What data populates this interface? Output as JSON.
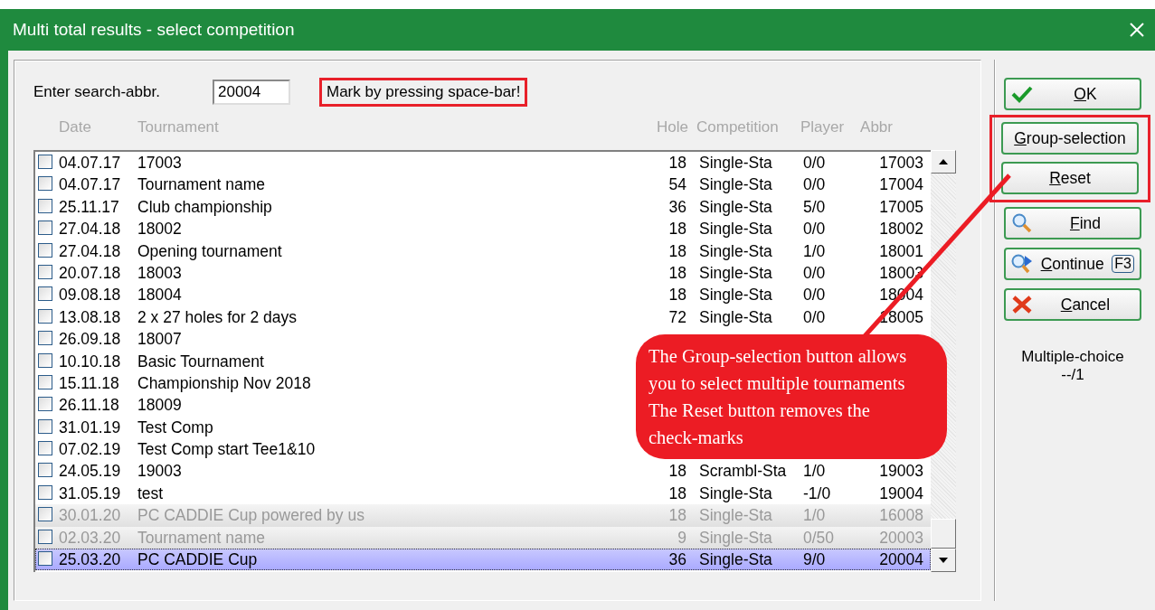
{
  "window": {
    "title": "Multi total results - select competition"
  },
  "search": {
    "label": "Enter search-abbr.",
    "value": "20004"
  },
  "hint": "Mark by pressing space-bar!",
  "table": {
    "columns": [
      "Date",
      "Tournament",
      "Hole",
      "Competition",
      "Player",
      "Abbr"
    ],
    "rows": [
      {
        "date": "04.07.17",
        "tournament": "17003",
        "hole": "18",
        "competition": "Single-Sta",
        "player": "0/0",
        "abbr": "17003",
        "checked": false,
        "selected": false,
        "greyed": false
      },
      {
        "date": "04.07.17",
        "tournament": "Tournament name",
        "hole": "54",
        "competition": "Single-Sta",
        "player": "0/0",
        "abbr": "17004",
        "checked": false,
        "selected": false,
        "greyed": false
      },
      {
        "date": "25.11.17",
        "tournament": "Club championship",
        "hole": "36",
        "competition": "Single-Sta",
        "player": "5/0",
        "abbr": "17005",
        "checked": false,
        "selected": false,
        "greyed": false
      },
      {
        "date": "27.04.18",
        "tournament": "18002",
        "hole": "18",
        "competition": "Single-Sta",
        "player": "0/0",
        "abbr": "18002",
        "checked": false,
        "selected": false,
        "greyed": false
      },
      {
        "date": "27.04.18",
        "tournament": "Opening tournament",
        "hole": "18",
        "competition": "Single-Sta",
        "player": "1/0",
        "abbr": "18001",
        "checked": false,
        "selected": false,
        "greyed": false
      },
      {
        "date": "20.07.18",
        "tournament": "18003",
        "hole": "18",
        "competition": "Single-Sta",
        "player": "0/0",
        "abbr": "18003",
        "checked": false,
        "selected": false,
        "greyed": false
      },
      {
        "date": "09.08.18",
        "tournament": "18004",
        "hole": "18",
        "competition": "Single-Sta",
        "player": "0/0",
        "abbr": "18004",
        "checked": false,
        "selected": false,
        "greyed": false
      },
      {
        "date": "13.08.18",
        "tournament": "2 x 27 holes for 2 days",
        "hole": "72",
        "competition": "Single-Sta",
        "player": "0/0",
        "abbr": "18005",
        "checked": false,
        "selected": false,
        "greyed": false
      },
      {
        "date": "26.09.18",
        "tournament": "18007",
        "checked": false,
        "selected": false,
        "greyed": false
      },
      {
        "date": "10.10.18",
        "tournament": "Basic Tournament",
        "checked": false,
        "selected": false,
        "greyed": false
      },
      {
        "date": "15.11.18",
        "tournament": "Championship Nov 2018",
        "checked": false,
        "selected": false,
        "greyed": false
      },
      {
        "date": "26.11.18",
        "tournament": "18009",
        "checked": false,
        "selected": false,
        "greyed": false
      },
      {
        "date": "31.01.19",
        "tournament": "Test Comp",
        "checked": false,
        "selected": false,
        "greyed": false
      },
      {
        "date": "07.02.19",
        "tournament": "Test Comp start Tee1&10",
        "checked": false,
        "selected": false,
        "greyed": false
      },
      {
        "date": "24.05.19",
        "tournament": "19003",
        "hole": "18",
        "competition": "Scrambl-Sta",
        "player": "1/0",
        "abbr": "19003",
        "checked": false,
        "selected": false,
        "greyed": false
      },
      {
        "date": "31.05.19",
        "tournament": "test",
        "hole": "18",
        "competition": "Single-Sta",
        "player": "-1/0",
        "abbr": "19004",
        "checked": false,
        "selected": false,
        "greyed": false
      },
      {
        "date": "30.01.20",
        "tournament": "PC CADDIE Cup  powered by us",
        "hole": "18",
        "competition": "Single-Sta",
        "player": "1/0",
        "abbr": "16008",
        "checked": false,
        "selected": false,
        "greyed": true
      },
      {
        "date": "02.03.20",
        "tournament": "Tournament name",
        "hole": "9",
        "competition": "Single-Sta",
        "player": "0/50",
        "abbr": "20003",
        "checked": false,
        "selected": false,
        "greyed": true
      },
      {
        "date": "25.03.20",
        "tournament": "PC CADDIE Cup",
        "hole": "36",
        "competition": "Single-Sta",
        "player": "9/0",
        "abbr": "20004",
        "checked": false,
        "selected": true,
        "greyed": false
      }
    ]
  },
  "buttons_top": [
    {
      "kind": "ok",
      "label": "OK"
    }
  ],
  "highlighted_buttons": [
    {
      "label": "Group-selection"
    },
    {
      "label": "Reset"
    }
  ],
  "buttons_bottom": [
    {
      "kind": "find",
      "label": "Find"
    },
    {
      "kind": "continue",
      "label": "Continue",
      "key": "F3"
    },
    {
      "kind": "cancel",
      "label": "Cancel"
    }
  ],
  "multiple_choice": {
    "label": "Multiple-choice",
    "count": "--/1"
  },
  "callout": "The Group-selection button allows you to select multiple tournaments The Reset button removes the check-marks"
}
